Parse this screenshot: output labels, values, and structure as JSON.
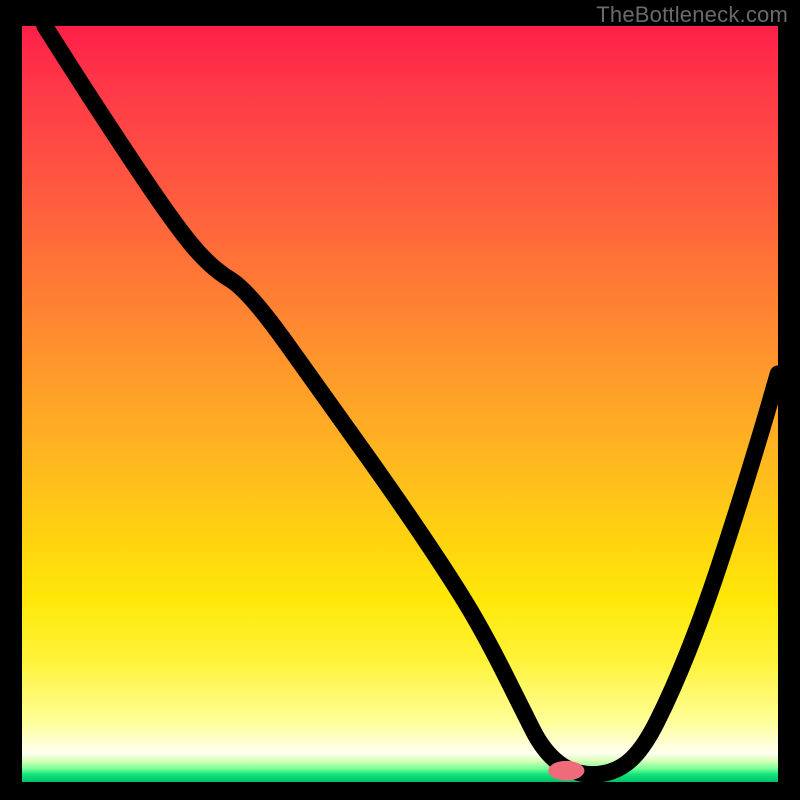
{
  "watermark": "TheBottleneck.com",
  "colors": {
    "frame": "#000000",
    "curve": "#000000",
    "marker": "#ef6b7a",
    "gradient_top": "#ff1f49",
    "gradient_mid": "#ffd40f",
    "gradient_bottom": "#00c06a"
  },
  "chart_data": {
    "type": "line",
    "title": "",
    "xlabel": "",
    "ylabel": "",
    "xlim": [
      0,
      100
    ],
    "ylim": [
      0,
      100
    ],
    "grid": false,
    "x": [
      3,
      10,
      20,
      25,
      30,
      40,
      50,
      58,
      62,
      66,
      69,
      73,
      78,
      82,
      86,
      90,
      94,
      98,
      100
    ],
    "y": [
      100,
      89,
      74,
      68,
      65,
      51,
      37,
      25,
      18,
      10,
      4,
      1,
      1,
      4,
      12,
      22,
      34,
      47,
      54
    ],
    "marker": {
      "x": 72,
      "y": 1.5,
      "rx": 2.4,
      "ry": 1.3
    },
    "notes": "y is percent height above the bottom edge; values estimated from pixels."
  }
}
